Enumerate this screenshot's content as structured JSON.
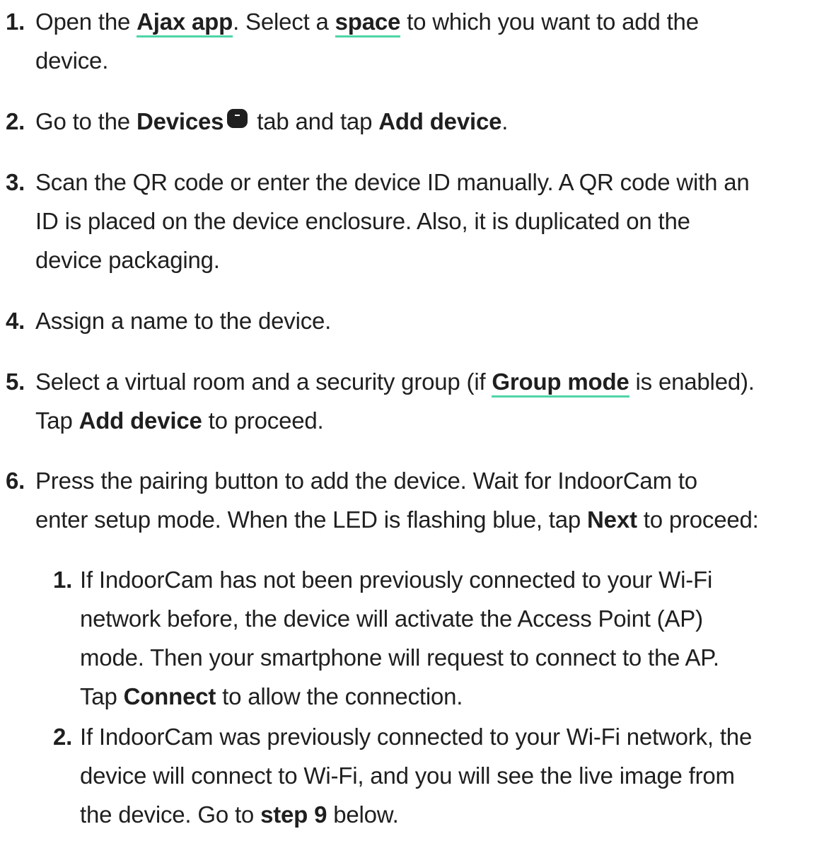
{
  "steps": [
    {
      "num": "1.",
      "lines": [
        {
          "pre": "Open the ",
          "link1": "Ajax app",
          "mid": ". Select a ",
          "link2": "space",
          "post": " to which you want to add the"
        },
        "device."
      ]
    },
    {
      "num": "2.",
      "pre": "Go to the ",
      "bold1": "Devices",
      "icon": "devices-tab-icon",
      "mid": " tab and tap ",
      "bold2": "Add device",
      "post": "."
    },
    {
      "num": "3.",
      "lines": [
        "Scan the QR code or enter the device ID manually. A QR code with an",
        "ID is placed on the device enclosure. Also, it is duplicated on the",
        "device packaging."
      ]
    },
    {
      "num": "4.",
      "lines": [
        "Assign a name to the device."
      ]
    },
    {
      "num": "5.",
      "line1": {
        "pre": "Select a virtual room and a security group (if ",
        "link": "Group mode",
        "post": " is enabled)."
      },
      "line2": {
        "pre": "Tap ",
        "bold": "Add device",
        "post": " to proceed."
      }
    },
    {
      "num": "6.",
      "line1": "Press the pairing button to add the device. Wait for IndoorCam to",
      "line2": {
        "pre": "enter setup mode. When the LED is flashing blue, tap ",
        "bold": "Next",
        "post": " to proceed:"
      },
      "substeps": [
        {
          "num": "1.",
          "lines": [
            "If IndoorCam has not been previously connected to your Wi-Fi",
            "network before, the device will activate the Access Point (AP)",
            "mode. Then your smartphone will request to connect to the AP."
          ],
          "last": {
            "pre": "Tap ",
            "bold": "Connect",
            "post": " to allow the connection."
          }
        },
        {
          "num": "2.",
          "lines": [
            "If IndoorCam was previously connected to your Wi-Fi network, the",
            "device will connect to Wi-Fi, and you will see the live image from"
          ],
          "last": {
            "pre": "the device. Go to ",
            "bold": "step 9",
            "post": " below."
          }
        }
      ]
    }
  ],
  "colors": {
    "text": "#1f1f1f",
    "link_underline": "#4fd4a6"
  }
}
